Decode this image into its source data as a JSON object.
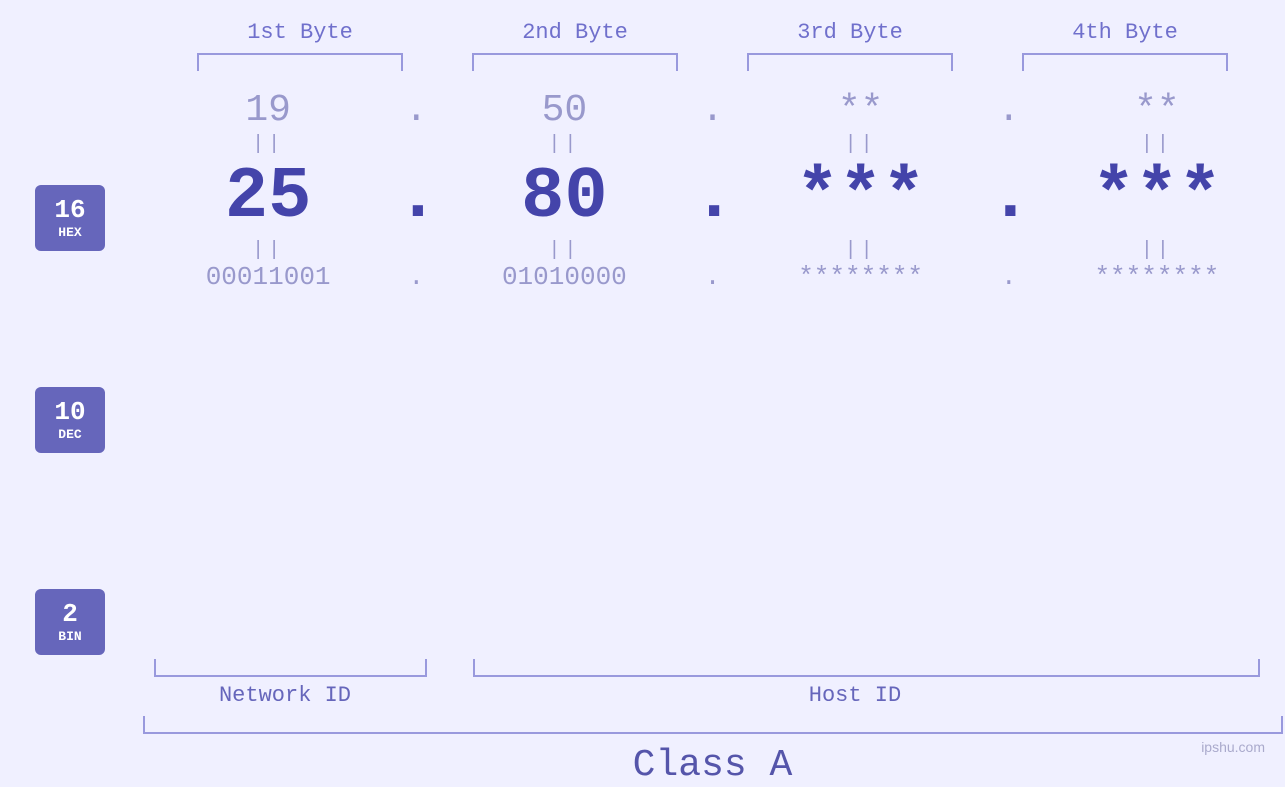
{
  "headers": {
    "byte1": "1st Byte",
    "byte2": "2nd Byte",
    "byte3": "3rd Byte",
    "byte4": "4th Byte"
  },
  "bases": [
    {
      "number": "16",
      "name": "HEX"
    },
    {
      "number": "10",
      "name": "DEC"
    },
    {
      "number": "2",
      "name": "BIN"
    }
  ],
  "rows": {
    "hex": {
      "b1": "19",
      "b2": "50",
      "b3": "**",
      "b4": "**",
      "dot": "."
    },
    "dec": {
      "b1": "25",
      "b2": "80",
      "b3": "***",
      "b4": "***",
      "dot": "."
    },
    "bin": {
      "b1": "00011001",
      "b2": "01010000",
      "b3": "********",
      "b4": "********",
      "dot": "."
    }
  },
  "labels": {
    "network_id": "Network ID",
    "host_id": "Host ID",
    "class": "Class A"
  },
  "watermark": "ipshu.com"
}
